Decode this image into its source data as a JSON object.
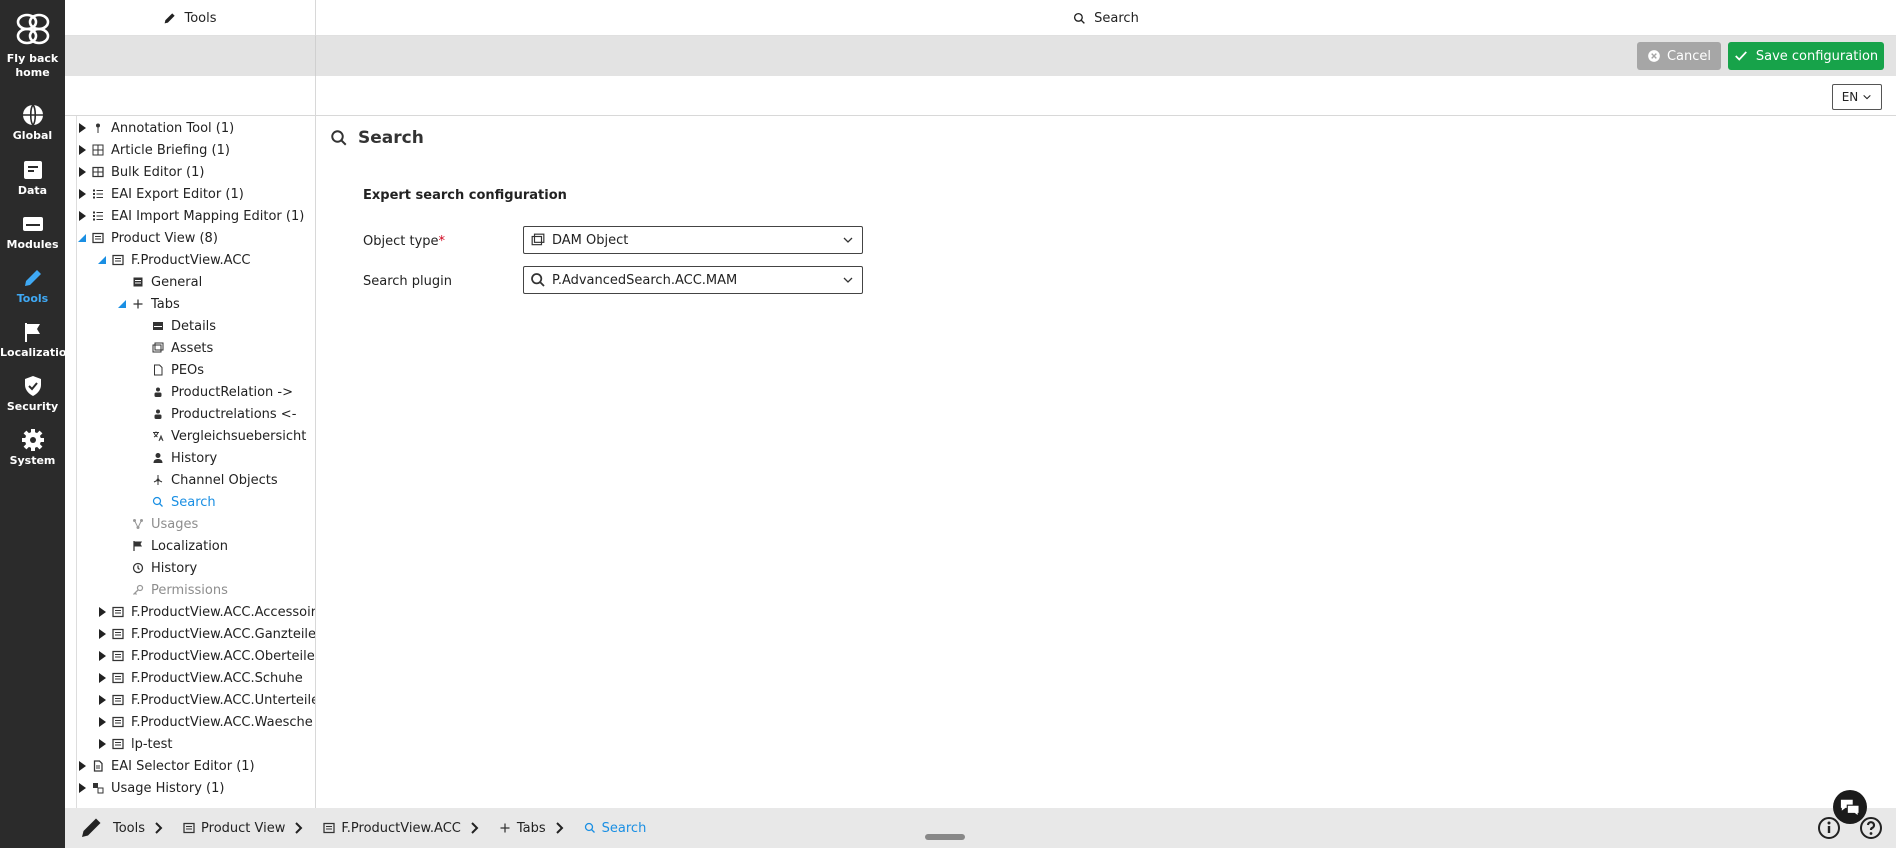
{
  "sidebar": {
    "items": [
      {
        "label": "Fly back home",
        "icon": "fly-home-icon"
      },
      {
        "label": "Global",
        "icon": "globe-icon"
      },
      {
        "label": "Data",
        "icon": "data-icon"
      },
      {
        "label": "Modules",
        "icon": "modules-icon"
      },
      {
        "label": "Tools",
        "icon": "pencil-icon",
        "active": true
      },
      {
        "label": "Localization",
        "icon": "flag-icon"
      },
      {
        "label": "Security",
        "icon": "shield-icon"
      },
      {
        "label": "System",
        "icon": "gear-icon"
      }
    ],
    "active_color": "#3fa9f5"
  },
  "header": {
    "tools_title": "Tools",
    "search_title": "Search"
  },
  "toolbar": {
    "cancel_label": "Cancel",
    "save_label": "Save configuration",
    "save_color": "#17a34a"
  },
  "language": {
    "value": "EN"
  },
  "tree": {
    "items": [
      {
        "label": "Annotation Tool (1)",
        "icon": "pin-icon"
      },
      {
        "label": "Article Briefing (1)",
        "icon": "briefing-icon"
      },
      {
        "label": "Bulk Editor (1)",
        "icon": "grid-icon"
      },
      {
        "label": "EAI Export Editor (1)",
        "icon": "list-icon"
      },
      {
        "label": "EAI Import Mapping Editor (1)",
        "icon": "list-icon"
      },
      {
        "label": "Product View (8)",
        "icon": "view-icon"
      },
      {
        "label": "F.ProductView.ACC",
        "icon": "view-icon"
      },
      {
        "label": "General",
        "icon": "general-icon"
      },
      {
        "label": "Tabs",
        "icon": "plus-icon"
      },
      {
        "label": "Details",
        "icon": "details-icon"
      },
      {
        "label": "Assets",
        "icon": "assets-icon"
      },
      {
        "label": "PEOs",
        "icon": "document-icon"
      },
      {
        "label": "ProductRelation ->",
        "icon": "relation-icon"
      },
      {
        "label": "Productrelations <-",
        "icon": "relation-icon"
      },
      {
        "label": "Vergleichsuebersicht",
        "icon": "translate-icon"
      },
      {
        "label": "History",
        "icon": "person-icon"
      },
      {
        "label": "Channel Objects",
        "icon": "channel-icon"
      },
      {
        "label": "Search",
        "icon": "search-icon"
      },
      {
        "label": "Usages",
        "icon": "usages-icon"
      },
      {
        "label": "Localization",
        "icon": "flag-icon"
      },
      {
        "label": "History",
        "icon": "history-icon"
      },
      {
        "label": "Permissions",
        "icon": "key-icon"
      },
      {
        "label": "F.ProductView.ACC.Accessoir.",
        "icon": "view-icon"
      },
      {
        "label": "F.ProductView.ACC.Ganzteile",
        "icon": "view-icon"
      },
      {
        "label": "F.ProductView.ACC.Oberteile",
        "icon": "view-icon"
      },
      {
        "label": "F.ProductView.ACC.Schuhe",
        "icon": "view-icon"
      },
      {
        "label": "F.ProductView.ACC.Unterteile",
        "icon": "view-icon"
      },
      {
        "label": "F.ProductView.ACC.Waesche",
        "icon": "view-icon"
      },
      {
        "label": "lp-test",
        "icon": "view-icon"
      },
      {
        "label": "EAI Selector Editor (1)",
        "icon": "document-icon"
      },
      {
        "label": "Usage History (1)",
        "icon": "usage-history-icon"
      }
    ]
  },
  "content": {
    "section_title": "Search",
    "subtitle": "Expert search configuration",
    "object_type_label": "Object type",
    "required_mark": "*",
    "object_type_value": "DAM Object",
    "search_plugin_label": "Search plugin",
    "search_plugin_value": "P.AdvancedSearch.ACC.MAM"
  },
  "breadcrumb": {
    "items": [
      {
        "label": "Tools"
      },
      {
        "label": "Product View"
      },
      {
        "label": "F.ProductView.ACC"
      },
      {
        "label": "Tabs"
      },
      {
        "label": "Search"
      }
    ]
  }
}
